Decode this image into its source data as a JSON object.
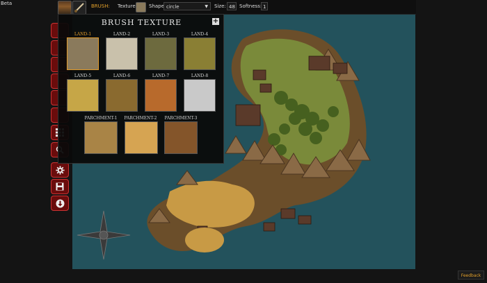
{
  "app": {
    "badge": "Beta"
  },
  "toolbar": {
    "brush_label": "BRUSH:",
    "texture_label": "Texture:",
    "shape_label": "Shape:",
    "shape_value": "circle",
    "size_label": "Size:",
    "size_value": "48",
    "softness_label": "Softness:",
    "softness_value": "1"
  },
  "brush_panel": {
    "title": "BRUSH TEXTURE",
    "add_symbol": "+",
    "textures": [
      {
        "label": "LAND-1",
        "color": "#8a7a5c",
        "selected": true
      },
      {
        "label": "LAND-2",
        "color": "#c9c1ab"
      },
      {
        "label": "LAND-3",
        "color": "#6d6a3e"
      },
      {
        "label": "LAND-4",
        "color": "#8a7f34"
      },
      {
        "label": "LAND-5",
        "color": "#c6a647"
      },
      {
        "label": "LAND-6",
        "color": "#8a6a2f"
      },
      {
        "label": "LAND-7",
        "color": "#b86a2c"
      },
      {
        "label": "LAND-8",
        "color": "#c9c9c9"
      },
      {
        "label": "PARCHMENT-1",
        "color": "#a98446"
      },
      {
        "label": "PARCHMENT-2",
        "color": "#d6a452"
      },
      {
        "label": "PARCHMENT-3",
        "color": "#84552a"
      }
    ]
  },
  "sidebar": {
    "buttons": [
      {
        "name": "tool-1-button",
        "icon": ""
      },
      {
        "name": "tool-2-button",
        "icon": ""
      },
      {
        "name": "tool-3-button",
        "icon": ""
      },
      {
        "name": "tool-4-button",
        "icon": ""
      },
      {
        "name": "tool-5-button",
        "icon": ""
      },
      {
        "name": "tool-6-button",
        "icon": ""
      },
      {
        "name": "grid-button",
        "icon": "grid-icon"
      },
      {
        "name": "zoom-button",
        "icon": "magnifier-icon"
      },
      {
        "name": "settings-button",
        "icon": "gear-icon"
      },
      {
        "name": "save-button",
        "icon": "floppy-disk-icon"
      },
      {
        "name": "download-button",
        "icon": "download-icon"
      }
    ]
  },
  "feedback": {
    "label": "Feedback"
  }
}
